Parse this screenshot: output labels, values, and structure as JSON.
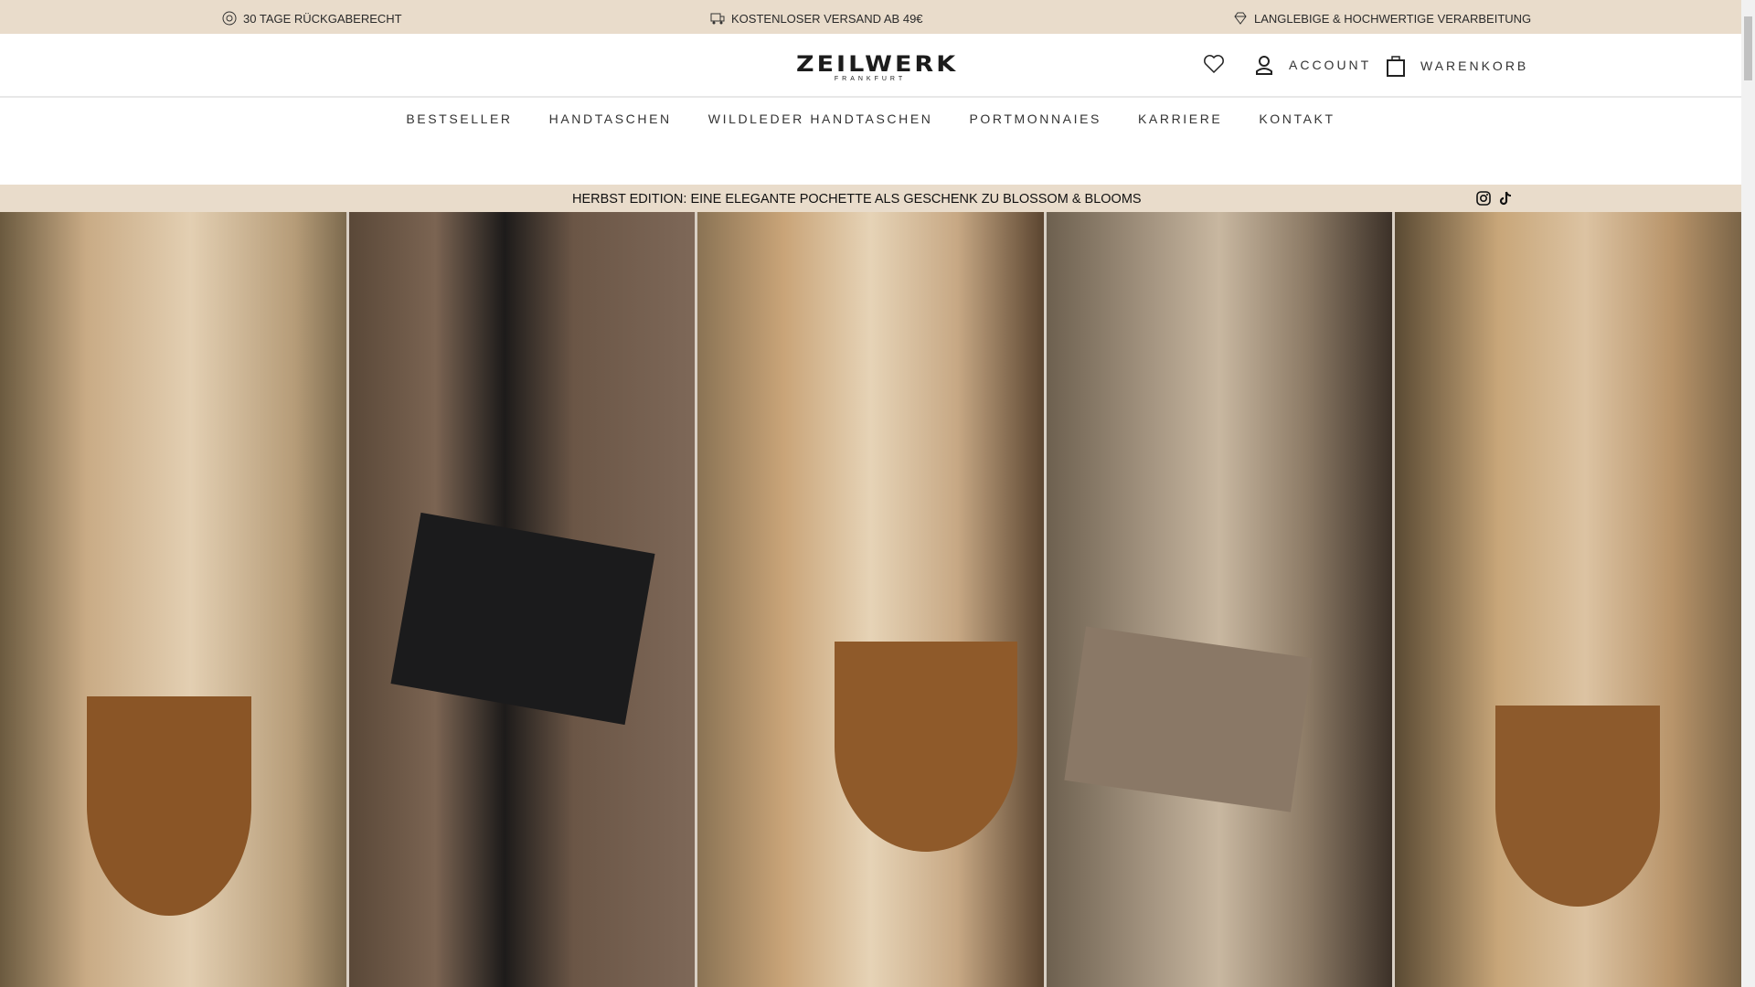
{
  "topbar": {
    "items": [
      {
        "icon": "return-icon",
        "label": "30 TAGE RÜCKGABERECHT"
      },
      {
        "icon": "truck-icon",
        "label": "KOSTENLOSER VERSAND AB 49€"
      },
      {
        "icon": "diamond-icon",
        "label": "LANGLEBIGE & HOCHWERTIGE VERARBEITUNG"
      }
    ]
  },
  "header": {
    "logo": "ZEILWERK",
    "logo_sub": "FRANKFURT",
    "account": "ACCOUNT",
    "cart": "WARENKORB"
  },
  "nav": [
    "BESTSELLER",
    "HANDTASCHEN",
    "WILDLEDER HANDTASCHEN",
    "PORTMONNAIES",
    "KARRIERE",
    "KONTAKT"
  ],
  "promo": {
    "text": "HERBST EDITION: EINE ELEGANTE POCHETTE ALS GESCHENK ZU BLOSSOM & BLOOMS"
  },
  "colors": {
    "bar": "#e9dccb",
    "text": "#1c1c1c"
  }
}
